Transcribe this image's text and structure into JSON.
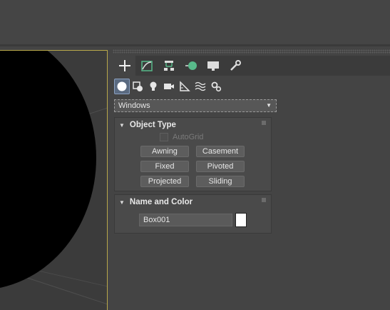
{
  "app": {
    "theme_bg": "#444444",
    "viewport_border_color": "#b8a84a"
  },
  "command_panel": {
    "tabs": [
      {
        "name": "create",
        "icon": "plus-icon",
        "active": true
      },
      {
        "name": "modify",
        "icon": "modify-curve-icon",
        "active": false
      },
      {
        "name": "hierarchy",
        "icon": "hierarchy-icon",
        "active": false
      },
      {
        "name": "motion",
        "icon": "motion-icon",
        "active": false
      },
      {
        "name": "display",
        "icon": "display-monitor-icon",
        "active": false
      },
      {
        "name": "utilities",
        "icon": "wrench-icon",
        "active": false
      }
    ],
    "create_categories": [
      {
        "name": "geometry",
        "icon": "sphere-icon",
        "active": true
      },
      {
        "name": "shapes",
        "icon": "shapes-icon",
        "active": false
      },
      {
        "name": "lights",
        "icon": "lightbulb-icon",
        "active": false
      },
      {
        "name": "cameras",
        "icon": "camera-icon",
        "active": false
      },
      {
        "name": "helpers",
        "icon": "helper-triangle-icon",
        "active": false
      },
      {
        "name": "space-warps",
        "icon": "waves-icon",
        "active": false
      },
      {
        "name": "systems",
        "icon": "gears-icon",
        "active": false
      }
    ],
    "category_dropdown": {
      "value": "Windows"
    },
    "object_type": {
      "title": "Object Type",
      "autogrid_label": "AutoGrid",
      "buttons": [
        "Awning",
        "Casement",
        "Fixed",
        "Pivoted",
        "Projected",
        "Sliding"
      ]
    },
    "name_and_color": {
      "title": "Name and Color",
      "name_value": "Box001",
      "swatch_color": "#ffffff"
    }
  }
}
